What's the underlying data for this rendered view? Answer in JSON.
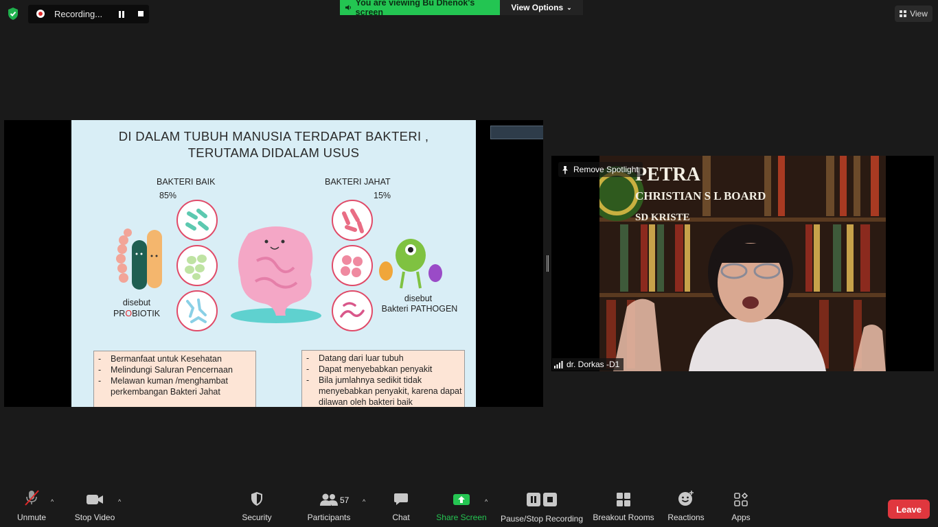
{
  "top_bar": {
    "recording_label": "Recording...",
    "viewing_banner": "You are viewing Bu Dhenok's screen",
    "view_options_label": "View Options",
    "view_label": "View"
  },
  "slide": {
    "title_line1": "DI DALAM TUBUH MANUSIA TERDAPAT BAKTERI ,",
    "title_line2": "TERUTAMA DIDALAM USUS",
    "good_heading": "BAKTERI BAIK",
    "good_percent": "85%",
    "bad_heading": "BAKTERI JAHAT",
    "bad_percent": "15%",
    "probiotik_line1": "disebut",
    "probiotik_line2_pre": "PR",
    "probiotik_line2_o": "O",
    "probiotik_line2_post": "BIOTIK",
    "pathogen_line1": "disebut",
    "pathogen_line2": "Bakteri PATHOGEN",
    "good_points": [
      "Bermanfaat untuk Kesehatan",
      "Melindungi Saluran Pencernaan",
      "Melawan kuman /menghambat perkembangan Bakteri Jahat"
    ],
    "bad_points": [
      "Datang dari luar tubuh",
      "Dapat menyebabkan penyakit",
      "Bila jumlahnya sedikit tidak menyebabkan penyakit, karena dapat dilawan oleh bakteri baik"
    ]
  },
  "video": {
    "spotlight_label": "Remove Spotlight",
    "participant_name": "dr. Dorkas -D1",
    "bg_text_line1": "PETRA",
    "bg_text_line2": "CHRISTIAN S    L BOARD",
    "bg_text_line3": "SD KRISTE"
  },
  "toolbar": {
    "unmute": "Unmute",
    "stop_video": "Stop Video",
    "security": "Security",
    "participants": "Participants",
    "participant_count": "57",
    "chat": "Chat",
    "share_screen": "Share Screen",
    "pause_stop_recording": "Pause/Stop Recording",
    "breakout_rooms": "Breakout Rooms",
    "reactions": "Reactions",
    "apps": "Apps",
    "leave": "Leave"
  },
  "colors": {
    "background": "#1a1a1a",
    "accent_green": "#23c552",
    "leave_red": "#e0373e",
    "slide_bg": "#d9eef6"
  }
}
